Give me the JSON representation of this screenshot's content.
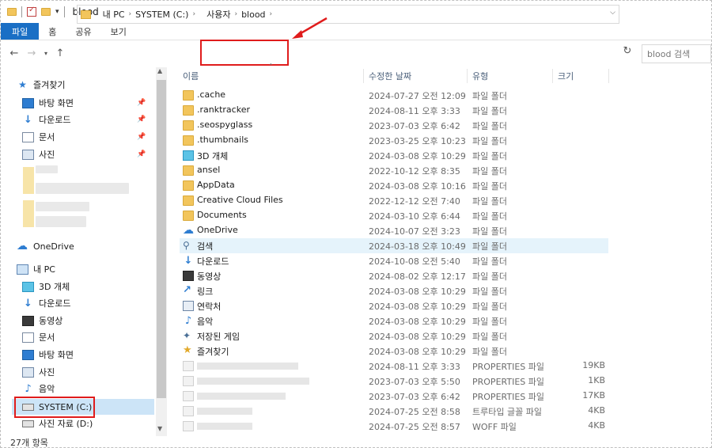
{
  "window": {
    "title": "blood"
  },
  "ribbon": {
    "tabs": [
      "파일",
      "홈",
      "공유",
      "보기"
    ]
  },
  "nav": {
    "address": [
      "내 PC",
      "SYSTEM (C:)",
      "사용자",
      "blood"
    ],
    "search_placeholder": "blood 검색"
  },
  "sidebar": {
    "quick_access": "즐겨찾기",
    "pinned": [
      "바탕 화면",
      "다운로드",
      "문서",
      "사진"
    ],
    "onedrive": "OneDrive",
    "this_pc": "내 PC",
    "pc_items": [
      "3D 개체",
      "다운로드",
      "동영상",
      "문서",
      "바탕 화면",
      "사진",
      "음악",
      "SYSTEM (C:)",
      "사진 자료 (D:)"
    ]
  },
  "columns": {
    "name": "이름",
    "date": "수정한 날짜",
    "type": "유형",
    "size": "크기"
  },
  "files": [
    {
      "name": ".cache",
      "date": "2024-07-27 오전 12:09",
      "type": "파일 폴더",
      "size": "",
      "icon": "folder-icon"
    },
    {
      "name": ".ranktracker",
      "date": "2024-08-11 오후 3:33",
      "type": "파일 폴더",
      "size": "",
      "icon": "folder-icon"
    },
    {
      "name": ".seospyglass",
      "date": "2023-07-03 오후 6:42",
      "type": "파일 폴더",
      "size": "",
      "icon": "folder-icon"
    },
    {
      "name": ".thumbnails",
      "date": "2023-03-25 오후 10:23",
      "type": "파일 폴더",
      "size": "",
      "icon": "folder-icon"
    },
    {
      "name": "3D 개체",
      "date": "2024-03-08 오후 10:29",
      "type": "파일 폴더",
      "size": "",
      "icon": "3d-objects-icon"
    },
    {
      "name": "ansel",
      "date": "2022-10-12 오후 8:35",
      "type": "파일 폴더",
      "size": "",
      "icon": "folder-icon"
    },
    {
      "name": "AppData",
      "date": "2024-03-08 오후 10:16",
      "type": "파일 폴더",
      "size": "",
      "icon": "folder-icon"
    },
    {
      "name": "Creative Cloud Files",
      "date": "2022-12-12 오전 7:40",
      "type": "파일 폴더",
      "size": "",
      "icon": "folder-icon"
    },
    {
      "name": "Documents",
      "date": "2024-03-10 오후 6:44",
      "type": "파일 폴더",
      "size": "",
      "icon": "folder-icon"
    },
    {
      "name": "OneDrive",
      "date": "2024-10-07 오전 3:23",
      "type": "파일 폴더",
      "size": "",
      "icon": "cloud-icon"
    },
    {
      "name": "검색",
      "date": "2024-03-18 오후 10:49",
      "type": "파일 폴더",
      "size": "",
      "icon": "search-icon"
    },
    {
      "name": "다운로드",
      "date": "2024-10-08 오전 5:40",
      "type": "파일 폴더",
      "size": "",
      "icon": "download-icon"
    },
    {
      "name": "동영상",
      "date": "2024-08-02 오후 12:17",
      "type": "파일 폴더",
      "size": "",
      "icon": "video-icon"
    },
    {
      "name": "링크",
      "date": "2024-03-08 오후 10:29",
      "type": "파일 폴더",
      "size": "",
      "icon": "link-icon"
    },
    {
      "name": "연락처",
      "date": "2024-03-08 오후 10:29",
      "type": "파일 폴더",
      "size": "",
      "icon": "contacts-icon"
    },
    {
      "name": "음악",
      "date": "2024-03-08 오후 10:29",
      "type": "파일 폴더",
      "size": "",
      "icon": "music-icon"
    },
    {
      "name": "저장된 게임",
      "date": "2024-03-08 오후 10:29",
      "type": "파일 폴더",
      "size": "",
      "icon": "saved-games-icon"
    },
    {
      "name": "즐겨찾기",
      "date": "2024-03-08 오후 10:29",
      "type": "파일 폴더",
      "size": "",
      "icon": "star-icon"
    },
    {
      "name": "",
      "date": "2024-08-11 오후 3:33",
      "type": "PROPERTIES 파일",
      "size": "19KB",
      "icon": "file-icon"
    },
    {
      "name": "",
      "date": "2023-07-03 오후 5:50",
      "type": "PROPERTIES 파일",
      "size": "1KB",
      "icon": "file-icon"
    },
    {
      "name": "",
      "date": "2023-07-03 오후 6:42",
      "type": "PROPERTIES 파일",
      "size": "17KB",
      "icon": "file-icon"
    },
    {
      "name": "",
      "date": "2024-07-25 오전 8:58",
      "type": "트루타입 글꼴 파일",
      "size": "4KB",
      "icon": "font-file-icon"
    },
    {
      "name": "",
      "date": "2024-07-25 오전 8:57",
      "type": "WOFF 파일",
      "size": "4KB",
      "icon": "file-icon"
    }
  ],
  "status": {
    "count": "27개 항목"
  },
  "colors": {
    "accent": "#1a6fc5",
    "highlight": "#e01c1c",
    "hover_row": "#e5f3fb",
    "selected": "#cce4f7"
  }
}
